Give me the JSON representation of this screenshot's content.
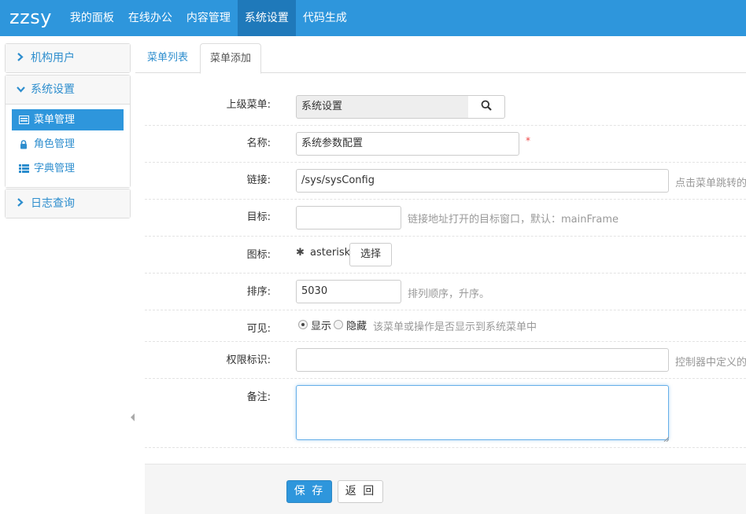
{
  "navbar": {
    "brand": "zzsy",
    "items": [
      {
        "label": "我的面板"
      },
      {
        "label": "在线办公"
      },
      {
        "label": "内容管理"
      },
      {
        "label": "系统设置",
        "active": true
      },
      {
        "label": "代码生成"
      }
    ]
  },
  "sidebar": {
    "panels": [
      {
        "title": "机构用户",
        "expanded": false
      },
      {
        "title": "系统设置",
        "expanded": true,
        "links": [
          {
            "label": "菜单管理",
            "icon": "list-icon",
            "active": true
          },
          {
            "label": "角色管理",
            "icon": "lock-icon"
          },
          {
            "label": "字典管理",
            "icon": "th-list-icon"
          }
        ]
      },
      {
        "title": "日志查询",
        "expanded": false
      }
    ]
  },
  "tabs": [
    {
      "label": "菜单列表"
    },
    {
      "label": "菜单添加",
      "active": true
    }
  ],
  "form": {
    "parent": {
      "label": "上级菜单:",
      "value": "系统设置"
    },
    "name": {
      "label": "名称:",
      "value": "系统参数配置",
      "required": "*"
    },
    "href": {
      "label": "链接:",
      "value": "/sys/sysConfig",
      "help": "点击菜单跳转的页"
    },
    "target": {
      "label": "目标:",
      "value": "",
      "help": "链接地址打开的目标窗口，默认：mainFrame"
    },
    "icon": {
      "label": "图标:",
      "glyph": "✱",
      "value": "asterisk",
      "button": "选择"
    },
    "sort": {
      "label": "排序:",
      "value": "5030",
      "help": "排列顺序，升序。"
    },
    "visible": {
      "label": "可见:",
      "options": [
        "显示",
        "隐藏"
      ],
      "selected": "显示",
      "help": "该菜单或操作是否显示到系统菜单中"
    },
    "permission": {
      "label": "权限标识:",
      "value": "",
      "help": "控制器中定义的权"
    },
    "remarks": {
      "label": "备注:",
      "value": ""
    }
  },
  "actions": {
    "save": "保 存",
    "back": "返 回"
  },
  "colors": {
    "primary": "#2e96dc",
    "nav_active": "#1f79ba",
    "link": "#2e8ece",
    "required": "#ee4444"
  }
}
